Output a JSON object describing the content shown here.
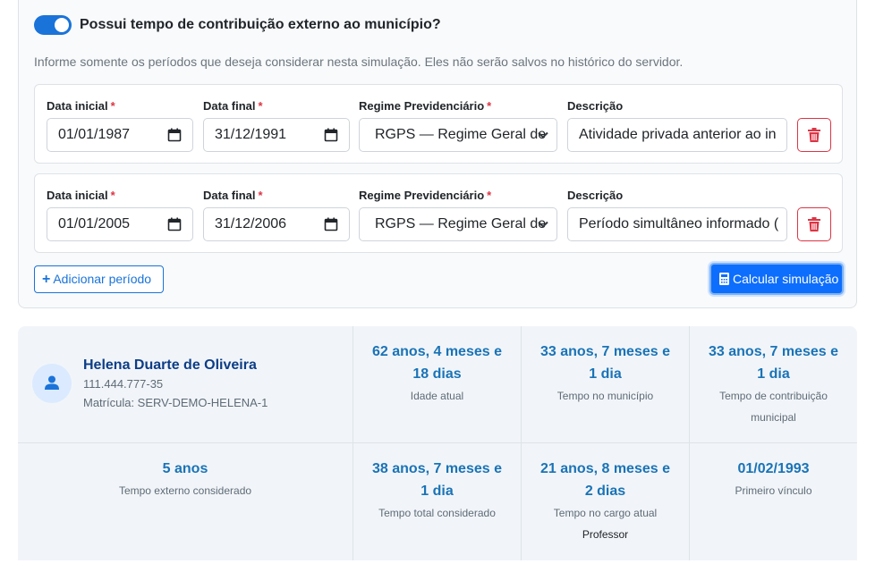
{
  "external_time": {
    "toggle_on": true,
    "toggle_label": "Possui tempo de contribuição externo ao município?",
    "hint": "Informe somente os períodos que deseja considerar nesta simulação. Eles não serão salvos no histórico do servidor.",
    "labels": {
      "start": "Data inicial",
      "end": "Data final",
      "regime": "Regime Previdenciário",
      "description": "Descrição",
      "required": "*"
    },
    "periods": [
      {
        "start": "01/01/1987",
        "end": "31/12/1991",
        "regime": "RGPS — Regime Geral de",
        "description": "Atividade privada anterior ao in"
      },
      {
        "start": "01/01/2005",
        "end": "31/12/2006",
        "regime": "RGPS — Regime Geral de",
        "description": "Período simultâneo informado ("
      }
    ],
    "add_button": "Adicionar período",
    "calc_button": "Calcular simulação"
  },
  "summary": {
    "person": {
      "name": "Helena Duarte de Oliveira",
      "cpf": "111.444.777-35",
      "registration": "Matrícula: SERV-DEMO-HELENA-1"
    },
    "stats": [
      {
        "line1": "62 anos, 4 meses e",
        "line2": "18 dias",
        "label": "Idade atual"
      },
      {
        "line1": "33 anos, 7 meses e",
        "line2": "1 dia",
        "label": "Tempo no município"
      },
      {
        "line1": "33 anos, 7 meses e",
        "line2": "1 dia",
        "label": "Tempo de contribuição",
        "label2": "municipal"
      },
      {
        "line1": "5 anos",
        "label": "Tempo externo considerado"
      },
      {
        "line1": "38 anos, 7 meses e",
        "line2": "1 dia",
        "label": "Tempo total considerado"
      },
      {
        "line1": "21 anos, 8 meses e",
        "line2": "2 dias",
        "label": "Tempo no cargo atual",
        "extra": "Professor"
      },
      {
        "line1": "01/02/1993",
        "label": "Primeiro vínculo"
      }
    ]
  }
}
